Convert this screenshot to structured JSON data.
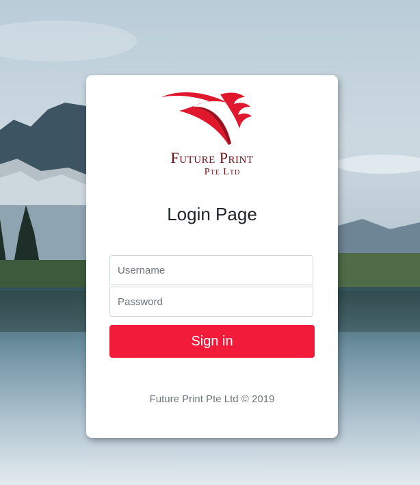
{
  "background": {
    "icon": "mountain-lake-landscape"
  },
  "brand": {
    "name_line1": "Future Print",
    "name_line2": "Pte Ltd",
    "logo_icon": "flame-f-logo",
    "logo_color": "#e0182d",
    "text_color": "#6b1015"
  },
  "login": {
    "title": "Login Page",
    "username_placeholder": "Username",
    "username_value": "",
    "password_placeholder": "Password",
    "password_value": "",
    "submit_label": "Sign in",
    "accent_color": "#f21b3a"
  },
  "footer": {
    "copyright": "Future Print Pte Ltd © 2019"
  }
}
